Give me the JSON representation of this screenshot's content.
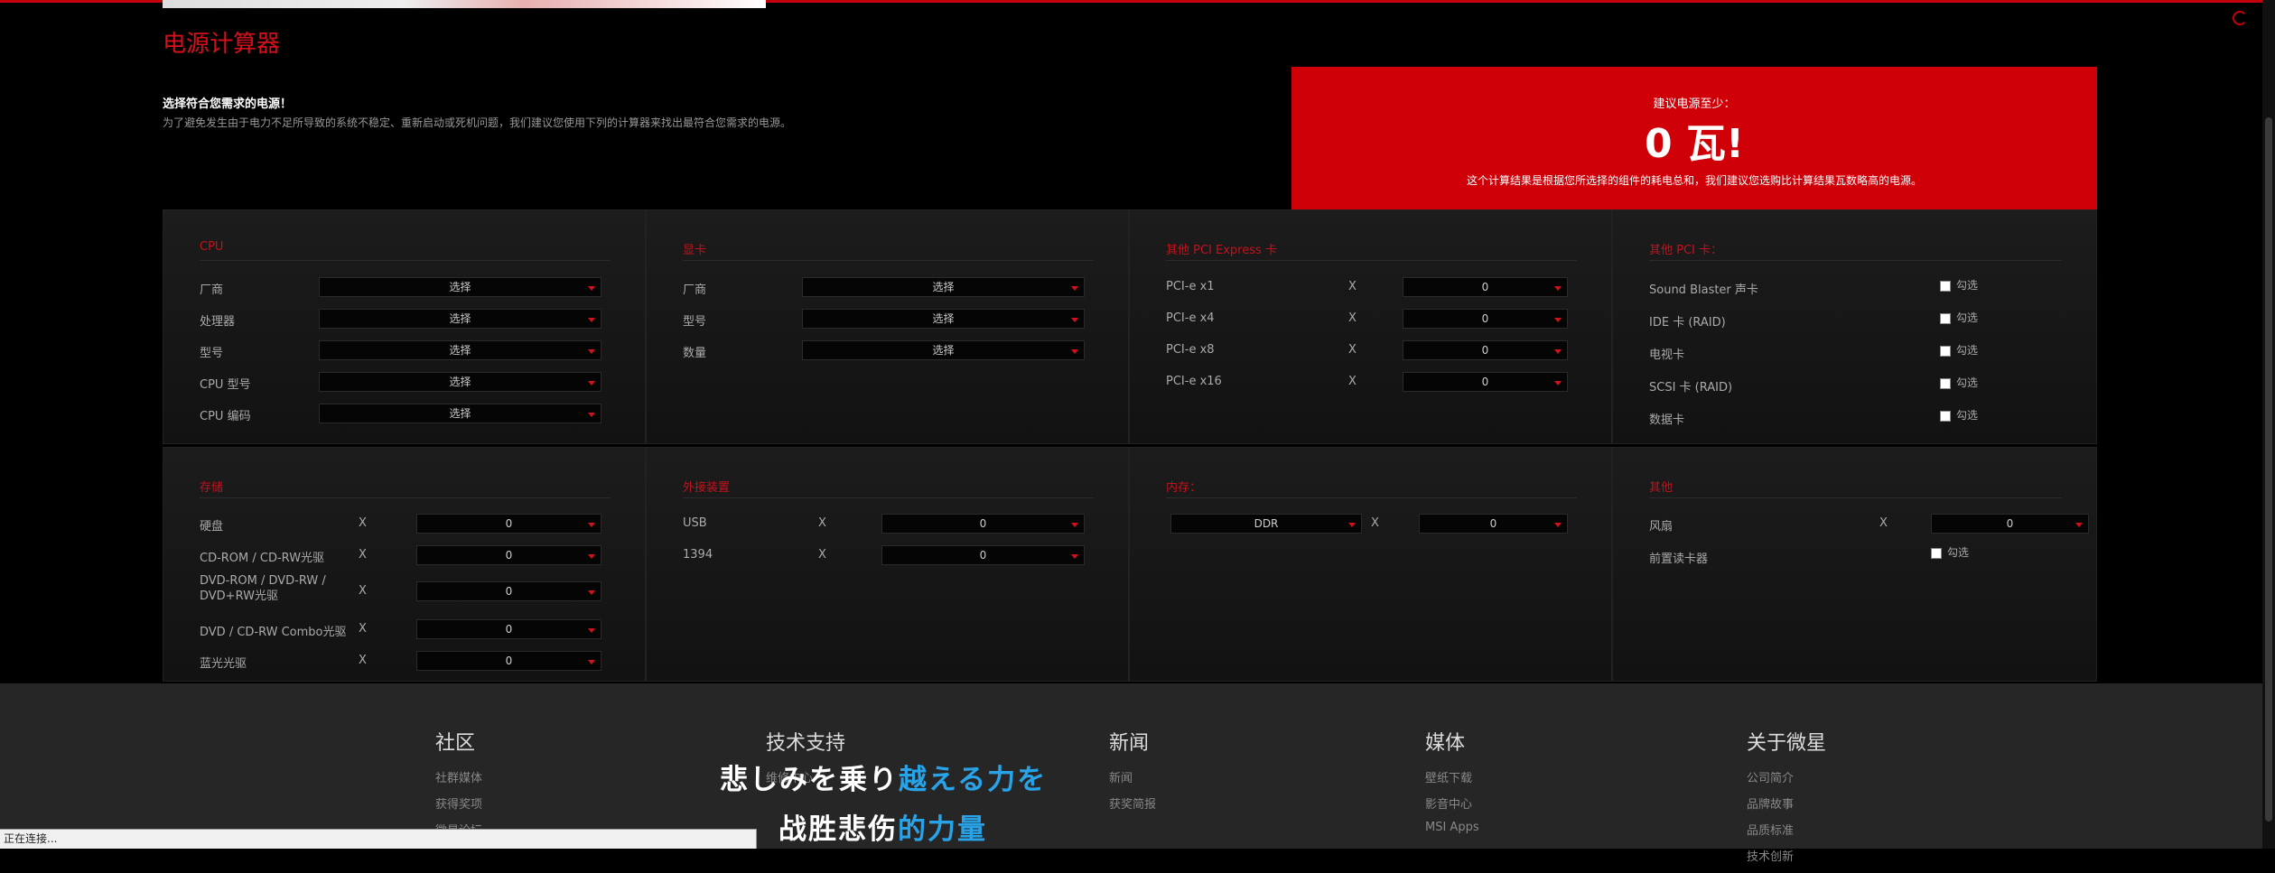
{
  "page_title": "电源计算器",
  "intro": {
    "heading": "选择符合您需求的电源！",
    "text": "为了避免发生由于电力不足所导致的系统不稳定、重新启动或死机问题，我们建议您使用下列的计算器来找出最符合您需求的电源。"
  },
  "recommendation": {
    "label": "建议电源至少：",
    "value": "0 瓦!",
    "note": "这个计算结果是根据您所选择的组件的耗电总和，我们建议您选购比计算结果瓦数略高的电源。"
  },
  "cpu": {
    "title": "CPU",
    "rows": [
      {
        "label": "厂商",
        "value": "选择"
      },
      {
        "label": "处理器",
        "value": "选择"
      },
      {
        "label": "型号",
        "value": "选择"
      },
      {
        "label": "CPU 型号",
        "value": "选择"
      },
      {
        "label": "CPU 编码",
        "value": "选择"
      }
    ]
  },
  "gpu": {
    "title": "显卡",
    "rows": [
      {
        "label": "厂商",
        "value": "选择"
      },
      {
        "label": "型号",
        "value": "选择"
      },
      {
        "label": "数量",
        "value": "选择"
      }
    ]
  },
  "pcie": {
    "title": "其他 PCI Express 卡",
    "rows": [
      {
        "label": "PCI-e x1",
        "times": "X",
        "value": "0"
      },
      {
        "label": "PCI-e x4",
        "times": "X",
        "value": "0"
      },
      {
        "label": "PCI-e x8",
        "times": "X",
        "value": "0"
      },
      {
        "label": "PCI-e x16",
        "times": "X",
        "value": "0"
      }
    ]
  },
  "pci": {
    "title": "其他 PCI 卡：",
    "rows": [
      {
        "label": "Sound Blaster 声卡",
        "check": "勾选"
      },
      {
        "label": "IDE 卡 (RAID)",
        "check": "勾选"
      },
      {
        "label": "电视卡",
        "check": "勾选"
      },
      {
        "label": "SCSI 卡 (RAID)",
        "check": "勾选"
      },
      {
        "label": "数据卡",
        "check": "勾选"
      }
    ]
  },
  "storage": {
    "title": "存储",
    "rows": [
      {
        "label": "硬盘",
        "times": "X",
        "value": "0"
      },
      {
        "label": "CD-ROM / CD-RW光驱",
        "times": "X",
        "value": "0"
      },
      {
        "label": "DVD-ROM / DVD-RW / DVD+RW光驱",
        "times": "X",
        "value": "0"
      },
      {
        "label": "DVD / CD-RW Combo光驱",
        "times": "X",
        "value": "0"
      },
      {
        "label": "蓝光光驱",
        "times": "X",
        "value": "0"
      }
    ]
  },
  "external": {
    "title": "外接装置",
    "rows": [
      {
        "label": "USB",
        "times": "X",
        "value": "0"
      },
      {
        "label": "1394",
        "times": "X",
        "value": "0"
      }
    ]
  },
  "memory": {
    "title": "内存：",
    "type_value": "DDR",
    "times": "X",
    "value": "0"
  },
  "other": {
    "title": "其他",
    "fan_label": "风扇",
    "fan_times": "X",
    "fan_value": "0",
    "reader_label": "前置读卡器",
    "reader_check": "勾选"
  },
  "footer": {
    "columns": [
      {
        "heading": "社区",
        "links": [
          "社群媒体",
          "获得奖项",
          "微星论坛"
        ]
      },
      {
        "heading": "技术支持",
        "links": [
          "",
          "维修中心",
          "",
          ""
        ]
      },
      {
        "heading": "新闻",
        "links": [
          "新闻",
          "获奖简报"
        ]
      },
      {
        "heading": "媒体",
        "links": [
          "壁纸下载",
          "影音中心",
          "MSI Apps"
        ]
      },
      {
        "heading": "关于微星",
        "links": [
          "公司简介",
          "品牌故事",
          "品质标准",
          "技术创新"
        ]
      }
    ]
  },
  "overlay": {
    "line1_white": "悲しみを乗り",
    "line1_blue": "越える力を",
    "line2_white": "战胜悲伤",
    "line2_blue": "的力量"
  },
  "status_bar": "正在连接..."
}
